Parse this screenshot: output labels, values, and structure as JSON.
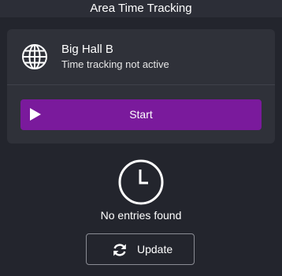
{
  "header": {
    "title": "Area Time Tracking"
  },
  "area_card": {
    "icon": "globe-icon",
    "name": "Big Hall B",
    "status": "Time tracking not active",
    "start_label": "Start",
    "accent_color": "#7a1a9c"
  },
  "entries": {
    "icon": "clock-icon",
    "empty_message": "No entries found"
  },
  "update_button": {
    "icon": "refresh-icon",
    "label": "Update"
  }
}
